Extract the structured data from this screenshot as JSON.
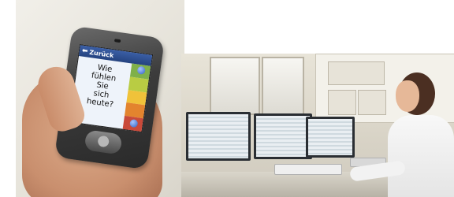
{
  "phone_screen": {
    "back_label": "Zurück",
    "question_lines": [
      "Wie",
      "fühlen",
      "Sie",
      "sich",
      "heute?"
    ]
  },
  "colors": {
    "mood_scale": [
      "#7fb04a",
      "#b9cc43",
      "#f0c23a",
      "#e3842e",
      "#c94a3a"
    ],
    "screen_header": "#24427f"
  }
}
